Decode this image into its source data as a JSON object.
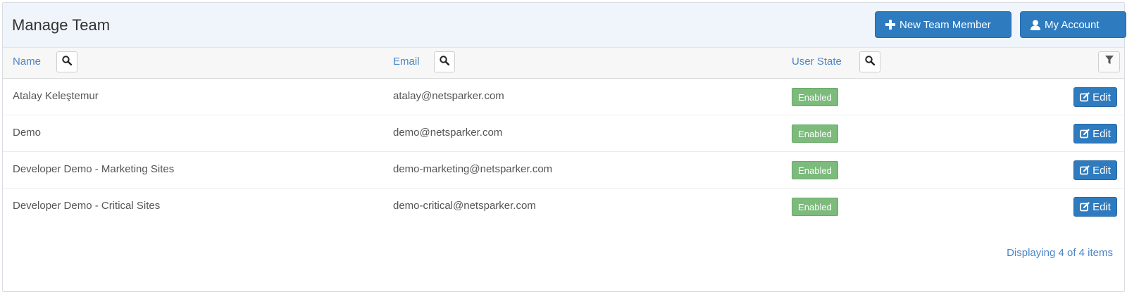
{
  "header": {
    "title": "Manage Team",
    "new_member_label": "New Team Member",
    "my_account_label": "My Account"
  },
  "columns": {
    "name": "Name",
    "email": "Email",
    "state": "User State"
  },
  "rows": [
    {
      "name": "Atalay Keleştemur",
      "email": "atalay@netsparker.com",
      "state": "Enabled",
      "action": "Edit"
    },
    {
      "name": "Demo",
      "email": "demo@netsparker.com",
      "state": "Enabled",
      "action": "Edit"
    },
    {
      "name": "Developer Demo - Marketing Sites",
      "email": "demo-marketing@netsparker.com",
      "state": "Enabled",
      "action": "Edit"
    },
    {
      "name": "Developer Demo - Critical Sites",
      "email": "demo-critical@netsparker.com",
      "state": "Enabled",
      "action": "Edit"
    }
  ],
  "footer": {
    "paging_text": "Displaying 4 of 4 items"
  },
  "icons": {
    "new_member": "plus-icon",
    "my_account": "user-icon",
    "search": "search-icon",
    "filter": "filter-icon",
    "edit": "edit-icon"
  },
  "colors": {
    "primary": "#2f7bbf",
    "enabled_badge": "#7dbb7d",
    "link": "#4c86c6",
    "header_bg": "#f0f5fc"
  }
}
